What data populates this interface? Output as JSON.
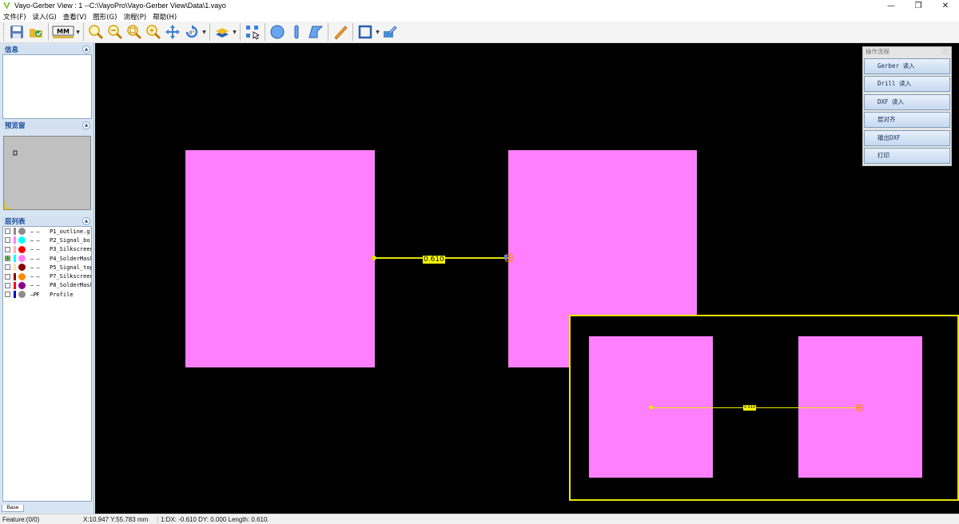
{
  "window": {
    "title": "Vayo-Gerber View : 1   --C:\\VayoPro\\Vayo-Gerber View\\Data\\1.vayo",
    "minimize": "—",
    "restore": "❐",
    "close": "✕"
  },
  "menu": [
    "文件(F)",
    "读入(G)",
    "查看(V)",
    "图形(G)",
    "流程(P)",
    "帮助(H)"
  ],
  "toolbar": {
    "units_label": "MM",
    "icons": [
      "save-icon",
      "open-icon",
      "units-mm-icon",
      "zoom-in-icon",
      "zoom-out-icon",
      "zoom-window-icon",
      "zoom-fit-icon",
      "pan-icon",
      "rotate-icon",
      "layer-icon",
      "select-icon",
      "circle-icon",
      "line-icon",
      "polygon-icon",
      "measure-icon",
      "rectangle-icon",
      "export-icon"
    ]
  },
  "panels": {
    "info_title": "信息",
    "preview_title": "预览窗",
    "layers_title": "层列表"
  },
  "layers": [
    {
      "type": "— —",
      "name": "P1_outline.gl",
      "bar": "#8c8c8c",
      "dot": "#8c8c8c",
      "checked": false
    },
    {
      "type": "— —",
      "name": "P2_Signal_bo",
      "bar": "#ff7fff",
      "dot": "#00ffff",
      "checked": false
    },
    {
      "type": "— —",
      "name": "P3_Silkscreen",
      "bar": "#ffb3b3",
      "dot": "#ff0000",
      "checked": false
    },
    {
      "type": "— —",
      "name": "P4_SolderMask",
      "bar": "#00ffff",
      "dot": "#ff7fff",
      "checked": true
    },
    {
      "type": "— —",
      "name": "P5_Signal_top",
      "bar": "#ffe0b0",
      "dot": "#8b0000",
      "checked": false
    },
    {
      "type": "— —",
      "name": "P7_Silkscreen",
      "bar": "#8b0000",
      "dot": "#ff8c00",
      "checked": false
    },
    {
      "type": "— —",
      "name": "P8_SolderMask",
      "bar": "#ff0000",
      "dot": "#8b008b",
      "checked": false
    },
    {
      "type": "—PF",
      "name": "Profile",
      "bar": "#0000cd",
      "dot": "#8c8c8c",
      "checked": false
    }
  ],
  "base_tab": "Base",
  "canvas": {
    "measure_value": "0.610",
    "zoom_measure_value": "0.610",
    "pad_color": "#ff7fff",
    "measure_color": "#e6e600"
  },
  "process_panel": {
    "title": "操作流程",
    "buttons": [
      "Gerber 读入",
      "Drill 读入",
      "DXF 读入",
      "层对齐",
      "输出DXF",
      "打印"
    ]
  },
  "status": {
    "feature": "Feature:(0/0)",
    "coords": "X:10.947 Y:55.783 mm",
    "measure": "1:DX: -0.610  DY: 0.000 Length: 0.610."
  }
}
